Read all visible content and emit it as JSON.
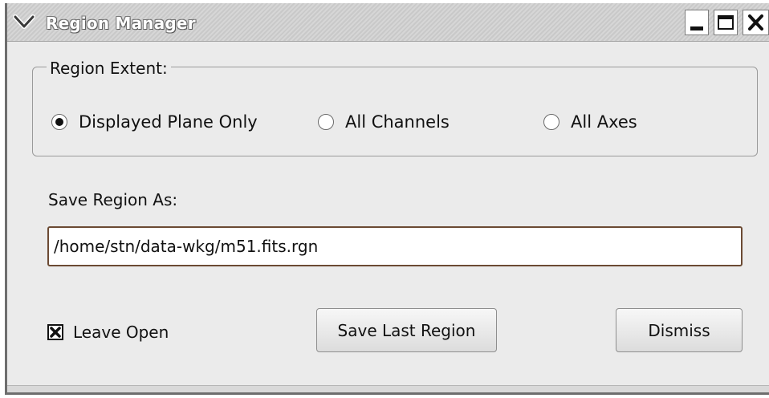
{
  "window": {
    "title": "Region Manager"
  },
  "region_extent": {
    "legend": "Region Extent:",
    "options": [
      {
        "label": "Displayed Plane Only",
        "selected": true
      },
      {
        "label": "All Channels",
        "selected": false
      },
      {
        "label": "All Axes",
        "selected": false
      }
    ]
  },
  "save": {
    "label": "Save Region As:",
    "value": "/home/stn/data-wkg/m51.fits.rgn"
  },
  "leave_open": {
    "label": "Leave Open",
    "checked": true
  },
  "buttons": {
    "save_last_region": "Save Last Region",
    "dismiss": "Dismiss"
  },
  "icons": {
    "menu": "chevron-down-icon",
    "minimize": "minimize-icon",
    "maximize": "maximize-icon",
    "close": "close-icon"
  },
  "colors": {
    "input_border": "#6b4a33",
    "window_bg": "#ebebeb"
  }
}
